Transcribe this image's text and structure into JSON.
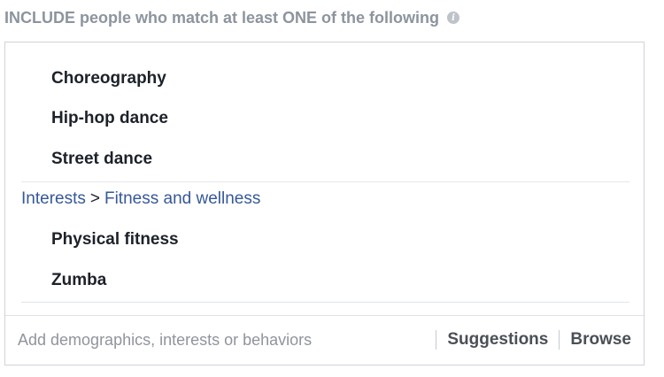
{
  "header": {
    "title": "INCLUDE people who match at least ONE of the following",
    "info_icon": "info-icon",
    "info_glyph": "i"
  },
  "targeting": {
    "group1_items": [
      "Choreography",
      "Hip-hop dance",
      "Street dance"
    ],
    "group2_breadcrumb": {
      "parent": "Interests",
      "separator": ">",
      "child": "Fitness and wellness"
    },
    "group2_items": [
      "Physical fitness",
      "Zumba"
    ]
  },
  "footer": {
    "search_placeholder": "Add demographics, interests or behaviors",
    "suggestions_label": "Suggestions",
    "browse_label": "Browse"
  },
  "colors": {
    "header_text": "#8d949e",
    "item_text": "#1d2129",
    "link": "#365899",
    "placeholder": "#90949c",
    "border": "#cfd3da"
  }
}
